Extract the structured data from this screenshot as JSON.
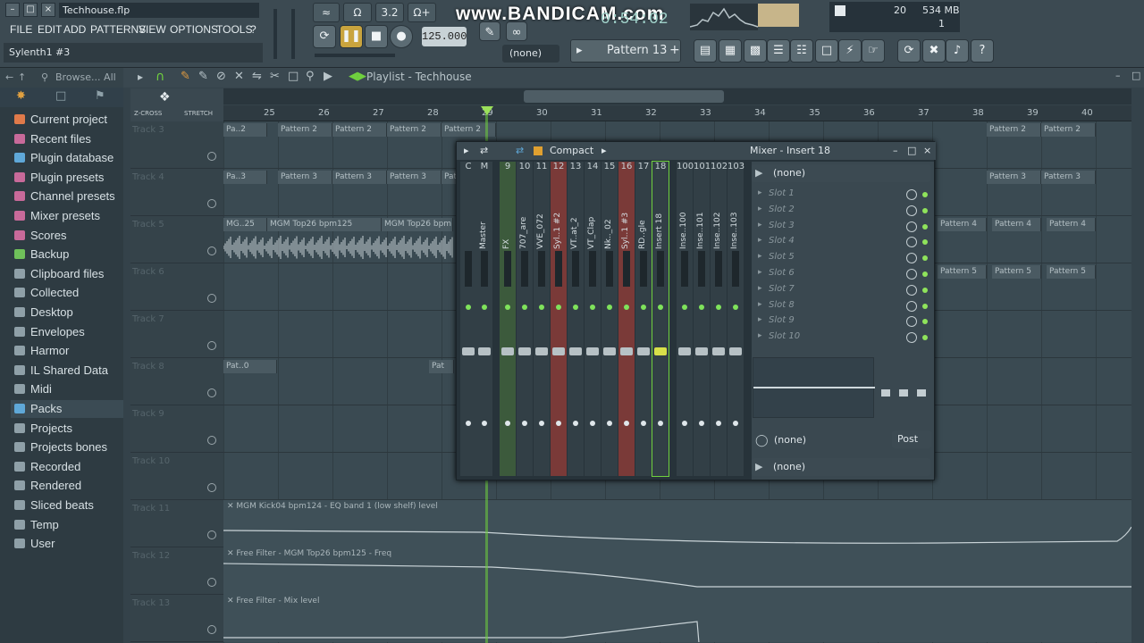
{
  "window": {
    "title": "Techhouse.flp",
    "hint": "Sylenth1 #3"
  },
  "menu": [
    "FILE",
    "EDIT",
    "ADD",
    "PATTERNS",
    "VIEW",
    "OPTIONS",
    "TOOLS",
    "?"
  ],
  "transport": {
    "tempo": "125.000",
    "time": "0:54:02",
    "pattern": "Pattern 13",
    "pattern_none": "(none)",
    "bandicam": "www.BANDICAM.com",
    "mode_label": "3.2"
  },
  "stats": {
    "mem": "534 MB",
    "cpu_val": "20",
    "voices": "1"
  },
  "browser": {
    "label": "Browse... All",
    "items": [
      {
        "label": "Current project",
        "icon": "project-icon",
        "color": "#e07a4a"
      },
      {
        "label": "Recent files",
        "icon": "recent-icon",
        "color": "#c86a9a"
      },
      {
        "label": "Plugin database",
        "icon": "plugin-db-icon",
        "color": "#5fa8d8"
      },
      {
        "label": "Plugin presets",
        "icon": "preset-icon",
        "color": "#c86a9a"
      },
      {
        "label": "Channel presets",
        "icon": "channel-preset-icon",
        "color": "#c86a9a"
      },
      {
        "label": "Mixer presets",
        "icon": "mixer-preset-icon",
        "color": "#c86a9a"
      },
      {
        "label": "Scores",
        "icon": "score-icon",
        "color": "#c86a9a"
      },
      {
        "label": "Backup",
        "icon": "backup-icon",
        "color": "#6fc05a"
      },
      {
        "label": "Clipboard files",
        "icon": "folder-icon",
        "color": "#8fa0a8"
      },
      {
        "label": "Collected",
        "icon": "folder-icon",
        "color": "#8fa0a8"
      },
      {
        "label": "Desktop",
        "icon": "folder-icon",
        "color": "#8fa0a8"
      },
      {
        "label": "Envelopes",
        "icon": "folder-icon",
        "color": "#8fa0a8"
      },
      {
        "label": "Harmor",
        "icon": "folder-icon",
        "color": "#8fa0a8"
      },
      {
        "label": "IL Shared Data",
        "icon": "folder-icon",
        "color": "#8fa0a8"
      },
      {
        "label": "Midi",
        "icon": "folder-icon",
        "color": "#8fa0a8"
      },
      {
        "label": "Packs",
        "icon": "packs-icon",
        "color": "#5fa8d8"
      },
      {
        "label": "Projects",
        "icon": "folder-icon",
        "color": "#8fa0a8"
      },
      {
        "label": "Projects bones",
        "icon": "folder-icon",
        "color": "#8fa0a8"
      },
      {
        "label": "Recorded",
        "icon": "recorded-icon",
        "color": "#8fa0a8"
      },
      {
        "label": "Rendered",
        "icon": "folder-icon",
        "color": "#8fa0a8"
      },
      {
        "label": "Sliced beats",
        "icon": "sliced-icon",
        "color": "#8fa0a8"
      },
      {
        "label": "Temp",
        "icon": "folder-icon",
        "color": "#8fa0a8"
      },
      {
        "label": "User",
        "icon": "user-icon",
        "color": "#8fa0a8"
      }
    ]
  },
  "playlist": {
    "title": "Playlist - Techhouse",
    "zcross": "Z-CROSS",
    "stretch": "STRETCH",
    "bars": [
      "25",
      "26",
      "27",
      "28",
      "29",
      "30",
      "31",
      "32",
      "33",
      "34",
      "35",
      "36",
      "37",
      "38",
      "39",
      "40"
    ],
    "tracks": [
      "Track 3",
      "Track 4",
      "Track 5",
      "Track 6",
      "Track 7",
      "Track 8",
      "Track 9",
      "Track 10",
      "Track 11",
      "Track 12",
      "Track 13"
    ],
    "clips": {
      "pattern2": "Pattern 2",
      "pattern3": "Pattern 3",
      "pa2": "Pa..2",
      "pa3": "Pa..3",
      "pattern4": "Pattern 4",
      "pattern5": "Pattern 5",
      "mgm25": "MG..25",
      "mgmtop": "MGM Top26 bpm125",
      "pat0": "Pat..0",
      "pat": "Pat"
    },
    "automation": [
      "MGM Kick04 bpm124 - EQ band 1 (low shelf) level",
      "Free Filter - MGM Top26 bpm125 - Freq",
      "Free Filter - Mix level"
    ]
  },
  "mixer": {
    "title": "Mixer - Insert 18",
    "mode": "Compact",
    "strips": [
      {
        "num": "C",
        "name": ""
      },
      {
        "num": "M",
        "name": "Master"
      },
      {
        "num": "9",
        "name": "FX"
      },
      {
        "num": "10",
        "name": "707_are"
      },
      {
        "num": "11",
        "name": "VVE_072"
      },
      {
        "num": "12",
        "name": "Syl..1 #2"
      },
      {
        "num": "13",
        "name": "VT..at_2"
      },
      {
        "num": "14",
        "name": "VT_Clap"
      },
      {
        "num": "15",
        "name": "Nk.._02"
      },
      {
        "num": "16",
        "name": "Syl..1 #3"
      },
      {
        "num": "17",
        "name": "RD..gle"
      },
      {
        "num": "18",
        "name": "Insert 18"
      },
      {
        "num": "100",
        "name": "Inse..100"
      },
      {
        "num": "101",
        "name": "Inse..101"
      },
      {
        "num": "102",
        "name": "Inse..102"
      },
      {
        "num": "103",
        "name": "Inse..103"
      }
    ],
    "input": "(none)",
    "slots": [
      "Slot 1",
      "Slot 2",
      "Slot 3",
      "Slot 4",
      "Slot 5",
      "Slot 6",
      "Slot 7",
      "Slot 8",
      "Slot 9",
      "Slot 10"
    ],
    "eq": "(none)",
    "post": "Post",
    "output": "(none)"
  }
}
